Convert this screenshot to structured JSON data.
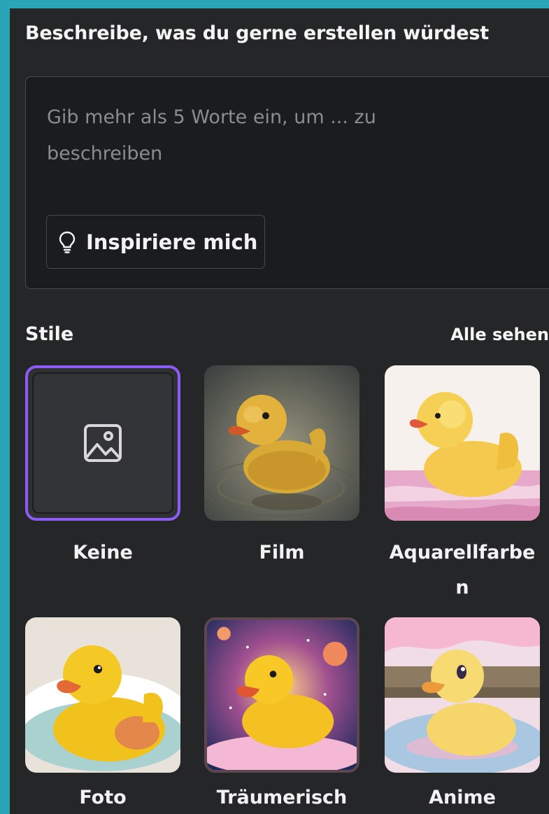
{
  "prompt": {
    "heading": "Beschreibe, was du gerne erstellen würdest",
    "placeholder": "Gib mehr als 5 Worte ein, um ... zu beschreiben",
    "inspire_label": "Inspiriere mich"
  },
  "styles": {
    "title": "Stile",
    "see_all": "Alle sehen",
    "selected": "Keine",
    "accent": "#8b5cf6",
    "items": [
      {
        "label": "Keine",
        "icon": "image-icon"
      },
      {
        "label": "Film"
      },
      {
        "label": "Aquarellfarbe\nn"
      },
      {
        "label": "Foto"
      },
      {
        "label": "Träumerisch"
      },
      {
        "label": "Anime"
      }
    ]
  }
}
